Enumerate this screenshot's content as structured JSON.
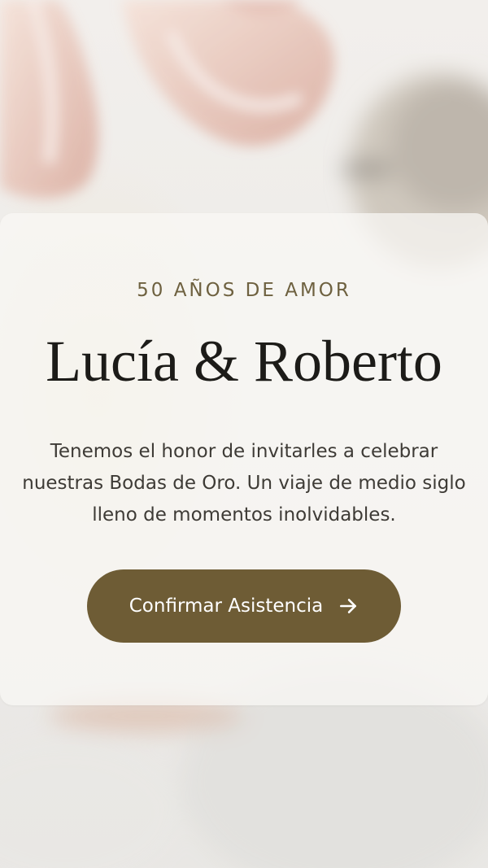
{
  "hero": {
    "eyebrow": "50 AÑOS DE AMOR",
    "couple_names": "Lucía & Roberto",
    "intro_lines": [
      "Tenemos el honor de invitarles a celebrar",
      "nuestras Bodas de Oro. Un viaje de medio siglo",
      "lleno de momentos inolvidables."
    ]
  },
  "cta": {
    "label": "Confirmar Asistencia",
    "icon": "arrow-right-icon"
  },
  "colors": {
    "accent": "#6e5c35",
    "eyebrow": "#6e6140",
    "title": "#1c1b18",
    "body": "#3e3b36"
  }
}
